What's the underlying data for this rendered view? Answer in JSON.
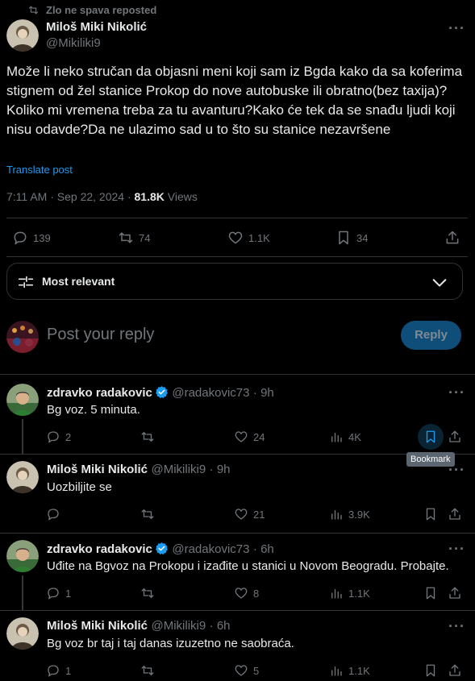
{
  "repost": {
    "label": "Zlo ne spava reposted"
  },
  "main_post": {
    "author_name": "Miloš Miki Nikolić",
    "author_handle": "@Mikiliki9",
    "text": "Može li neko stručan da objasni meni koji sam iz Bgda kako da sa koferima stignem od žel stanice Prokop do nove autobuske ili obratno(bez taxija)?Koliko mi vremena treba za tu avanturu?Kako će tek da se snađu ljudi koji nisu odavde?Da ne ulazimo sad u to što su stanice nezavršene",
    "translate": "Translate post",
    "timestamp": "7:11 AM · Sep 22, 2024 · ",
    "views_count": "81.8K",
    "views_label": " Views",
    "stats": {
      "replies": "139",
      "reposts": "74",
      "likes": "1.1K",
      "bookmarks": "34"
    }
  },
  "sort": {
    "label": "Most relevant"
  },
  "composer": {
    "placeholder": "Post your reply",
    "button": "Reply"
  },
  "tooltip": {
    "bookmark": "Bookmark"
  },
  "replies": [
    {
      "name": "zdravko radakovic",
      "verified": true,
      "handle": "@radakovic73",
      "time": "· 9h",
      "text": "Bg voz. 5 minuta.",
      "replies": "2",
      "reposts": "",
      "likes": "24",
      "views": "4K"
    },
    {
      "name": "Miloš Miki Nikolić",
      "verified": false,
      "handle": "@Mikiliki9",
      "time": "· 9h",
      "text": "Uozbiljite se",
      "replies": "",
      "reposts": "",
      "likes": "21",
      "views": "3.9K"
    },
    {
      "name": "zdravko radakovic",
      "verified": true,
      "handle": "@radakovic73",
      "time": "· 6h",
      "text": "Uđite na Bgvoz na Prokopu i izađite u stanici u Novom Beogradu. Probajte.",
      "replies": "1",
      "reposts": "",
      "likes": "8",
      "views": "1.1K"
    },
    {
      "name": "Miloš Miki Nikolić",
      "verified": false,
      "handle": "@Mikiliki9",
      "time": "· 6h",
      "text": "Bg voz br taj i taj danas izuzetno ne saobraća.",
      "replies": "1",
      "reposts": "",
      "likes": "5",
      "views": "1.1K"
    }
  ],
  "colors": {
    "accent": "#1d9bf0",
    "background": "#000000",
    "text": "#e7e9ea",
    "muted": "#71767b",
    "divider": "#2f3336"
  }
}
